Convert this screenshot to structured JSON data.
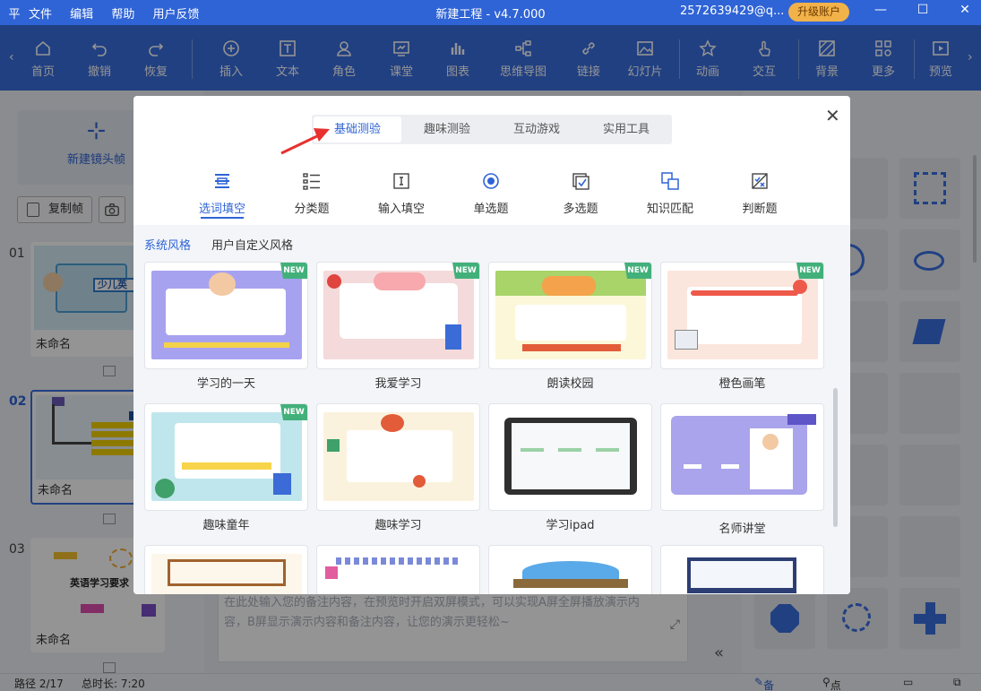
{
  "titlebar": {
    "logo": "平",
    "menu": [
      "文件",
      "编辑",
      "帮助",
      "用户反馈"
    ],
    "title": "新建工程 - v4.7.000",
    "account": "2572639429@q...",
    "upgrade": "升级账户"
  },
  "toolbar": {
    "items": [
      "首页",
      "撤销",
      "恢复",
      "插入",
      "文本",
      "角色",
      "课堂",
      "图表",
      "思维导图",
      "链接",
      "幻灯片",
      "动画",
      "交互",
      "背景",
      "更多",
      "预览"
    ]
  },
  "left": {
    "new_frame": "新建镜头帧",
    "copy_frame": "复制帧",
    "slides": [
      {
        "num": "01",
        "name": "未命名",
        "thumb_text": "少儿英"
      },
      {
        "num": "02",
        "name": "未命名",
        "thumb_text": ""
      },
      {
        "num": "03",
        "name": "未命名",
        "thumb_text": "英语学习要求"
      }
    ]
  },
  "notes": {
    "placeholder": "在此处输入您的备注内容，在预览时开启双屏模式，可以实现A屏全屏播放演示内容，B屏显示演示内容和备注内容，让您的演示更轻松~"
  },
  "statusbar": {
    "path": "路径 2/17",
    "duration": "总时长: 7:20",
    "notes_btn": "备注",
    "rollcall_btn": "点名"
  },
  "dialog": {
    "tabs": [
      "基础测验",
      "趣味测验",
      "互动游戏",
      "实用工具"
    ],
    "categories": [
      "选词填空",
      "分类题",
      "输入填空",
      "单选题",
      "多选题",
      "知识匹配",
      "判断题"
    ],
    "styles": [
      "系统风格",
      "用户自定义风格"
    ],
    "new_badge": "NEW",
    "templates": [
      {
        "name": "学习的一天",
        "is_new": true
      },
      {
        "name": "我爱学习",
        "is_new": true
      },
      {
        "name": "朗读校园",
        "is_new": true
      },
      {
        "name": "橙色画笔",
        "is_new": true
      },
      {
        "name": "趣味童年",
        "is_new": true
      },
      {
        "name": "趣味学习",
        "is_new": false
      },
      {
        "name": "学习ipad",
        "is_new": false
      },
      {
        "name": "名师讲堂",
        "is_new": false
      }
    ]
  }
}
